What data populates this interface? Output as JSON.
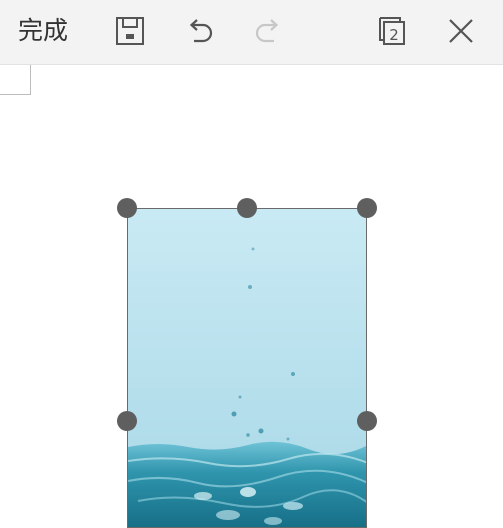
{
  "toolbar": {
    "done_label": "完成",
    "save_icon": "save-icon",
    "undo_icon": "undo-icon",
    "redo_icon": "redo-icon",
    "pages_count": "2",
    "close_icon": "close-icon"
  },
  "colors": {
    "toolbar_bg": "#f3f3f3",
    "handle": "#5f5f5f",
    "water": "#2f95ad"
  }
}
